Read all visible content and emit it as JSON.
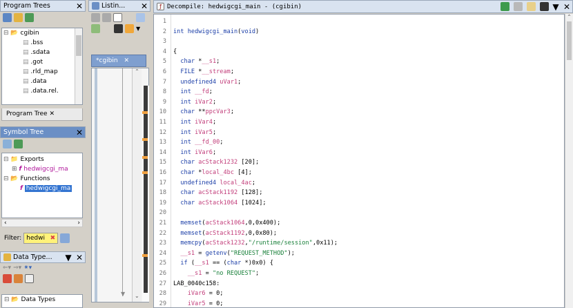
{
  "program_trees": {
    "title": "Program Trees",
    "root": "cgibin",
    "items": [
      ".bss",
      ".sdata",
      ".got",
      ".rld_map",
      ".data",
      ".data.rel."
    ],
    "tab_label": "Program Tree"
  },
  "symbol_tree": {
    "title": "Symbol Tree",
    "exports_label": "Exports",
    "export_item": "hedwigcgi_ma",
    "functions_label": "Functions",
    "function_item": "hedwigcgi_ma",
    "filter_label": "Filter:",
    "filter_value": "hedwi"
  },
  "data_types": {
    "title": "Data Type...",
    "root_label": "Data Types"
  },
  "listing": {
    "title": "Listin...",
    "tab_label": "*cgibin"
  },
  "decompile": {
    "title": "Decompile: hedwigcgi_main -  (cgibin)",
    "lines": [
      {
        "n": "1",
        "t": ""
      },
      {
        "n": "2",
        "t": "int hedwigcgi_main(void)"
      },
      {
        "n": "3",
        "t": ""
      },
      {
        "n": "4",
        "t": "{"
      },
      {
        "n": "5",
        "t": "  char *__s1;"
      },
      {
        "n": "6",
        "t": "  FILE *__stream;"
      },
      {
        "n": "7",
        "t": "  undefined4 uVar1;"
      },
      {
        "n": "8",
        "t": "  int __fd;"
      },
      {
        "n": "9",
        "t": "  int iVar2;"
      },
      {
        "n": "10",
        "t": "  char **ppcVar3;"
      },
      {
        "n": "11",
        "t": "  int iVar4;"
      },
      {
        "n": "12",
        "t": "  int iVar5;"
      },
      {
        "n": "13",
        "t": "  int __fd_00;"
      },
      {
        "n": "14",
        "t": "  int iVar6;"
      },
      {
        "n": "15",
        "t": "  char acStack1232 [20];"
      },
      {
        "n": "16",
        "t": "  char *local_4bc [4];"
      },
      {
        "n": "17",
        "t": "  undefined4 local_4ac;"
      },
      {
        "n": "18",
        "t": "  char acStack1192 [128];"
      },
      {
        "n": "19",
        "t": "  char acStack1064 [1024];"
      },
      {
        "n": "20",
        "t": ""
      },
      {
        "n": "21",
        "t": "  memset(acStack1064,0,0x400);"
      },
      {
        "n": "22",
        "t": "  memset(acStack1192,0,0x80);"
      },
      {
        "n": "23",
        "t": "  memcpy(acStack1232,\"/runtime/session\",0x11);"
      },
      {
        "n": "24",
        "t": "  __s1 = getenv(\"REQUEST_METHOD\");"
      },
      {
        "n": "25",
        "t": "  if (__s1 == (char *)0x0) {"
      },
      {
        "n": "26",
        "t": "    __s1 = \"no REQUEST\";"
      },
      {
        "n": "27",
        "t": "LAB_0040c158:"
      },
      {
        "n": "28",
        "t": "    iVar6 = 0;"
      },
      {
        "n": "29",
        "t": "    iVar5 = 0;"
      }
    ]
  }
}
